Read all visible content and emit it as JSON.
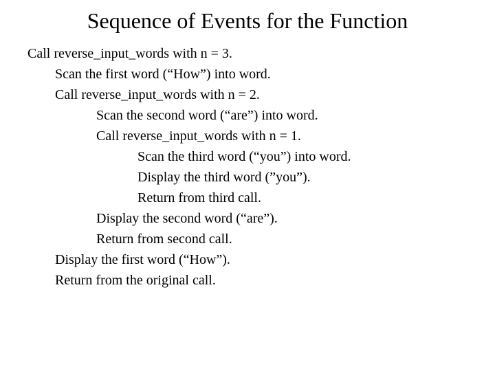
{
  "title": "Sequence of Events for the Function",
  "lines": {
    "l0": "Call reverse_input_words with n = 3.",
    "l1": "Scan the first word (“How”) into word.",
    "l2": "Call reverse_input_words with n = 2.",
    "l3": "Scan the second word (“are”) into word.",
    "l4": "Call reverse_input_words with n = 1.",
    "l5": "Scan the third word (“you”) into word.",
    "l6": "Display the third word (”you”).",
    "l7": "Return from third call.",
    "l8": "Display the second word (“are”).",
    "l9": "Return from second call.",
    "l10": "Display the first word (“How”).",
    "l11": "Return from the original call."
  }
}
